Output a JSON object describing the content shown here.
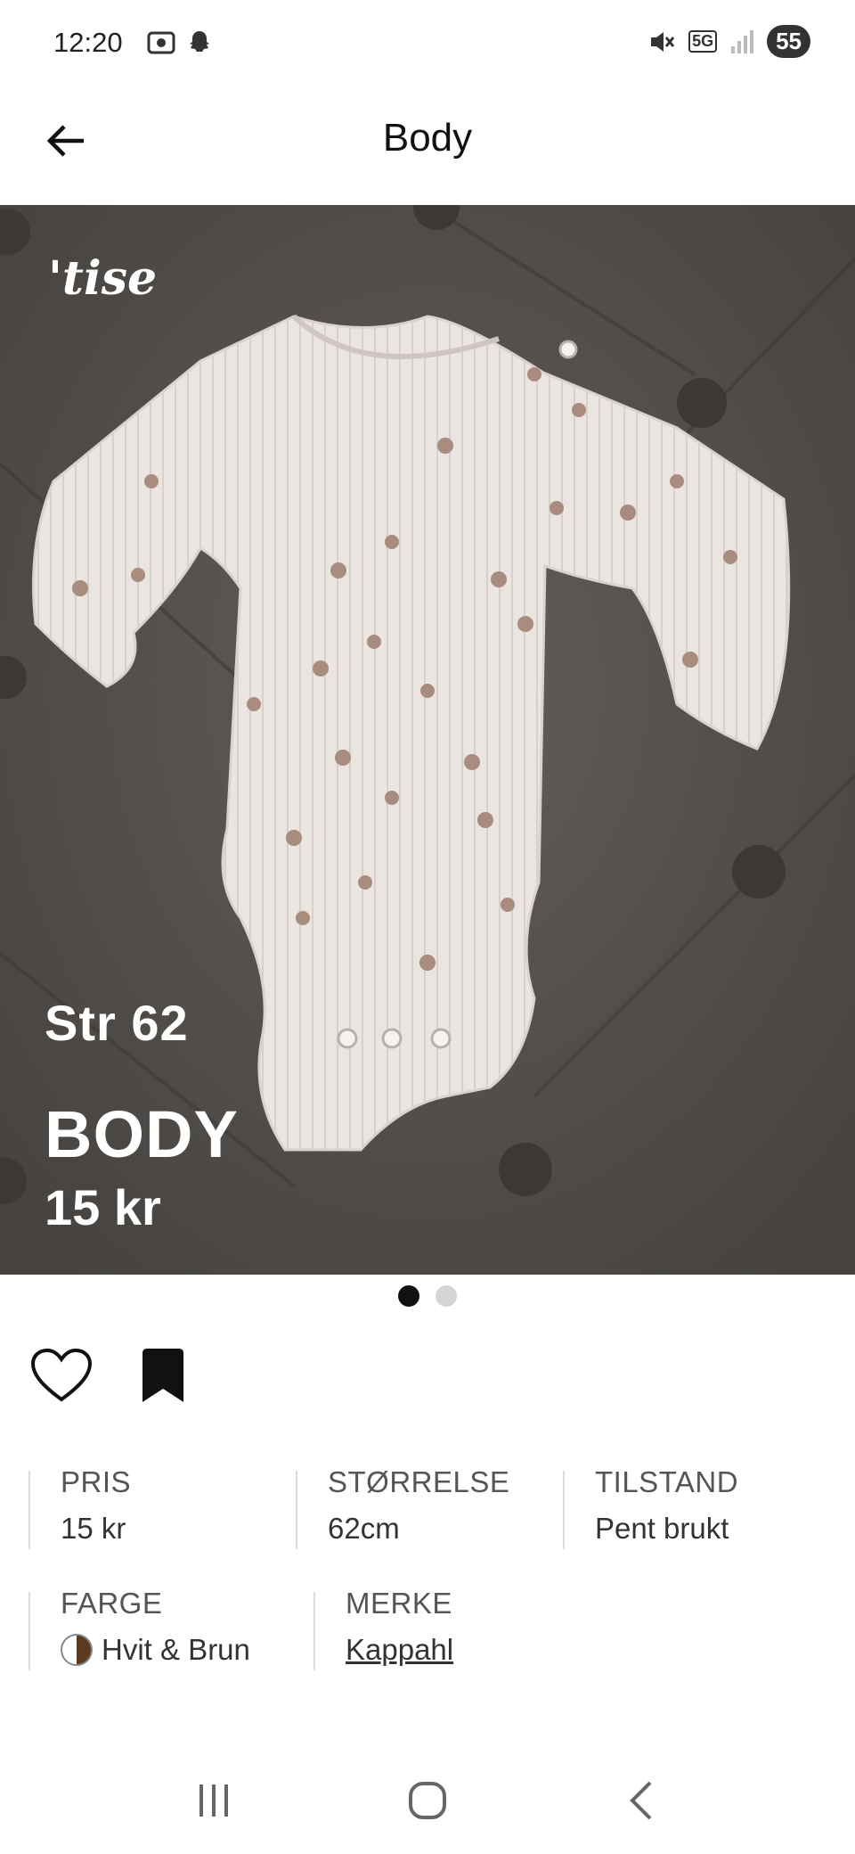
{
  "status_bar": {
    "time": "12:20",
    "network": "5G",
    "battery": "55"
  },
  "header": {
    "title": "Body"
  },
  "hero": {
    "logo": "'tise",
    "overlay_size": "Str 62",
    "overlay_title": "BODY",
    "overlay_price": "15 kr",
    "page_count": 2,
    "active_page": 1
  },
  "details": {
    "price": {
      "label": "PRIS",
      "value": "15 kr"
    },
    "size": {
      "label": "STØRRELSE",
      "value": "62cm"
    },
    "condition": {
      "label": "TILSTAND",
      "value": "Pent brukt"
    },
    "color": {
      "label": "FARGE",
      "value": "Hvit & Brun"
    },
    "brand": {
      "label": "MERKE",
      "value": "Kappahl"
    }
  },
  "colors": {
    "swatch_left": "#ffffff",
    "swatch_right": "#5b3a22",
    "image_background": "#5a5753",
    "garment": "#ebe5e2"
  },
  "icons": {
    "back": "arrow-left-icon",
    "like": "heart-icon",
    "save": "bookmark-icon",
    "nav_recent": "recent-apps-icon",
    "nav_home": "home-icon",
    "nav_back": "chevron-left-icon"
  }
}
